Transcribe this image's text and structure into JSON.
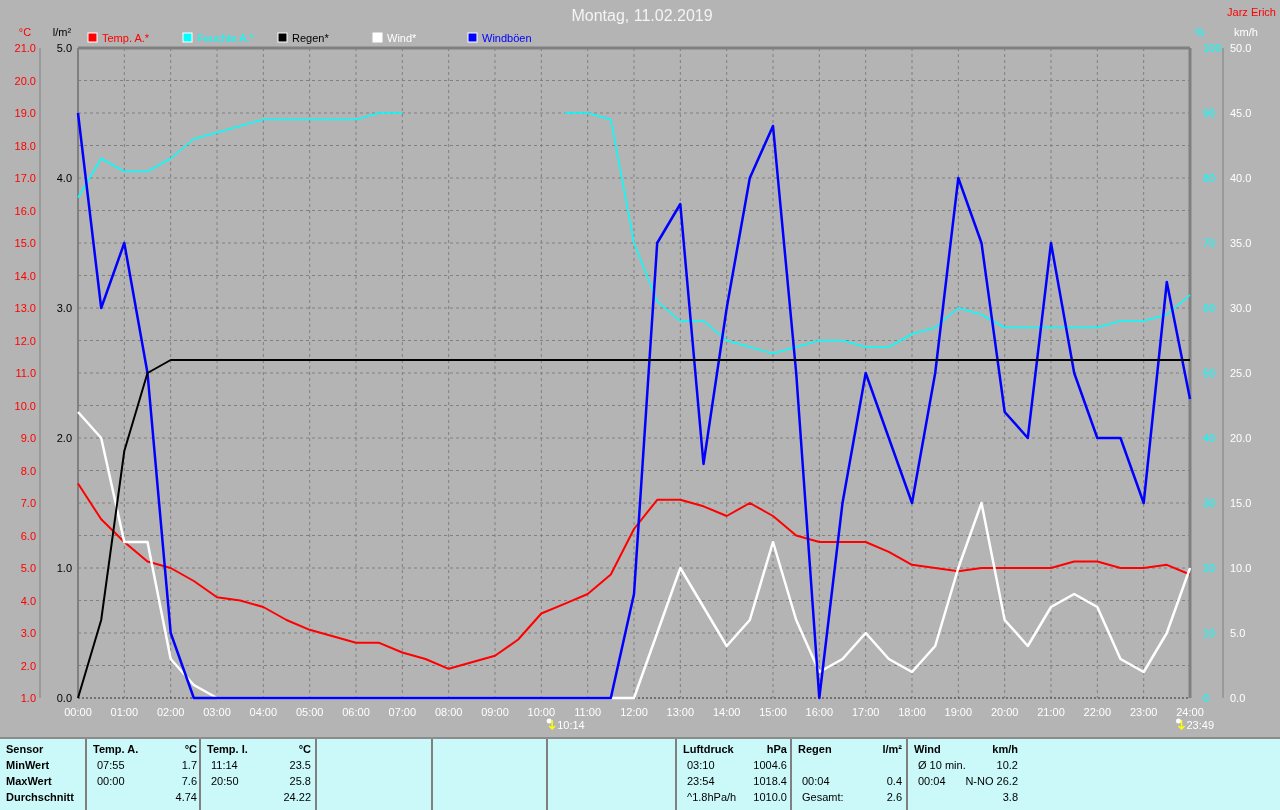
{
  "header": {
    "title": "Montag, 11.02.2019",
    "author": "Jarz Erich"
  },
  "chart": {
    "chart_data": {
      "type": "line",
      "x": [
        0,
        0.5,
        1,
        1.5,
        2,
        2.5,
        3,
        3.5,
        4,
        4.5,
        5,
        5.5,
        6,
        6.5,
        7,
        7.5,
        8,
        8.5,
        9,
        9.5,
        10,
        10.5,
        11,
        11.5,
        12,
        12.5,
        13,
        13.5,
        14,
        14.5,
        15,
        15.5,
        16,
        16.5,
        17,
        17.5,
        18,
        18.5,
        19,
        19.5,
        20,
        20.5,
        21,
        21.5,
        22,
        22.5,
        23,
        23.5,
        24
      ],
      "xlim": [
        0,
        24
      ],
      "xticks": [
        {
          "value": 0,
          "label": "00:00"
        },
        {
          "value": 1,
          "label": "01:00"
        },
        {
          "value": 2,
          "label": "02:00"
        },
        {
          "value": 3,
          "label": "03:00"
        },
        {
          "value": 4,
          "label": "04:00"
        },
        {
          "value": 5,
          "label": "05:00"
        },
        {
          "value": 6,
          "label": "06:00"
        },
        {
          "value": 7,
          "label": "07:00"
        },
        {
          "value": 8,
          "label": "08:00"
        },
        {
          "value": 9,
          "label": "09:00"
        },
        {
          "value": 10,
          "label": "10:00"
        },
        {
          "value": 11,
          "label": "11:00"
        },
        {
          "value": 12,
          "label": "12:00"
        },
        {
          "value": 13,
          "label": "13:00"
        },
        {
          "value": 14,
          "label": "14:00"
        },
        {
          "value": 15,
          "label": "15:00"
        },
        {
          "value": 16,
          "label": "16:00"
        },
        {
          "value": 17,
          "label": "17:00"
        },
        {
          "value": 18,
          "label": "18:00"
        },
        {
          "value": 19,
          "label": "19:00"
        },
        {
          "value": 20,
          "label": "20:00"
        },
        {
          "value": 21,
          "label": "21:00"
        },
        {
          "value": 22,
          "label": "22:00"
        },
        {
          "value": 23,
          "label": "23:00"
        },
        {
          "value": 24,
          "label": "24:00"
        }
      ],
      "ylabel": "°C",
      "ylim": [
        1,
        21
      ],
      "yticks": [
        {
          "value": 21,
          "label": "21.0"
        },
        {
          "value": 20,
          "label": "20.0"
        },
        {
          "value": 19,
          "label": "19.0"
        },
        {
          "value": 18,
          "label": "18.0"
        },
        {
          "value": 17,
          "label": "17.0"
        },
        {
          "value": 16,
          "label": "16.0"
        },
        {
          "value": 15,
          "label": "15.0"
        },
        {
          "value": 14,
          "label": "14.0"
        },
        {
          "value": 13,
          "label": "13.0"
        },
        {
          "value": 12,
          "label": "12.0"
        },
        {
          "value": 11,
          "label": "11.0"
        },
        {
          "value": 10,
          "label": "10.0"
        },
        {
          "value": 9,
          "label": "9.0"
        },
        {
          "value": 8,
          "label": "8.0"
        },
        {
          "value": 7,
          "label": "7.0"
        },
        {
          "value": 6,
          "label": "6.0"
        },
        {
          "value": 5,
          "label": "5.0"
        },
        {
          "value": 4,
          "label": "4.0"
        },
        {
          "value": 3,
          "label": "3.0"
        },
        {
          "value": 2,
          "label": "2.0"
        },
        {
          "value": 1,
          "label": "1.0"
        }
      ],
      "y2label": "km/h",
      "y2lim": [
        0,
        50
      ],
      "y2ticks": [
        {
          "value": 50,
          "label": "50.0"
        },
        {
          "value": 45,
          "label": "45.0"
        },
        {
          "value": 40,
          "label": "40.0"
        },
        {
          "value": 35,
          "label": "35.0"
        },
        {
          "value": 30,
          "label": "30.0"
        },
        {
          "value": 25,
          "label": "25.0"
        },
        {
          "value": 20,
          "label": "20.0"
        },
        {
          "value": 15,
          "label": "15.0"
        },
        {
          "value": 10,
          "label": "10.0"
        },
        {
          "value": 5,
          "label": "5.0"
        },
        {
          "value": 0,
          "label": "0.0"
        }
      ],
      "y3label": "%",
      "y3lim": [
        0,
        100
      ],
      "y3ticks": [
        100,
        90,
        80,
        70,
        60,
        50,
        40,
        30,
        20,
        10,
        0
      ],
      "series": [
        {
          "name": "Temp. A.*",
          "color": "#ff0000",
          "values": [
            7.6,
            6.5,
            5.8,
            5.2,
            5.0,
            4.6,
            4.1,
            4.0,
            3.8,
            3.4,
            3.1,
            2.9,
            2.7,
            2.7,
            2.4,
            2.2,
            1.9,
            2.1,
            2.3,
            2.8,
            3.6,
            3.9,
            4.2,
            4.8,
            6.2,
            7.1,
            7.1,
            6.9,
            6.6,
            7.0,
            6.6,
            6.0,
            5.8,
            5.8,
            5.8,
            5.5,
            5.1,
            5.0,
            4.9,
            5.0,
            5.0,
            5.0,
            5.0,
            5.2,
            5.2,
            5.0,
            5.0,
            5.1,
            4.8
          ]
        },
        {
          "name": "Feuchte A.*",
          "color": "#00ffff",
          "axis": "y3",
          "values": [
            77,
            83,
            81,
            81,
            83,
            86,
            87,
            88,
            89,
            89,
            89,
            89,
            89,
            90,
            90,
            null,
            null,
            null,
            null,
            null,
            null,
            90,
            90,
            89,
            70,
            61,
            58,
            58,
            55,
            54,
            53,
            54,
            55,
            55,
            54,
            54,
            56,
            57,
            60,
            59,
            57,
            57,
            57,
            57,
            57,
            58,
            58,
            59,
            62
          ]
        },
        {
          "name": "Wind*",
          "color": "#ffffff",
          "axis": "y2",
          "values": [
            22,
            20,
            12,
            12,
            3,
            1,
            0,
            0,
            0,
            0,
            0,
            0,
            0,
            0,
            0,
            0,
            0,
            0,
            0,
            0,
            0,
            0,
            0,
            0,
            0,
            5,
            10,
            7,
            4,
            6,
            12,
            6,
            2,
            3,
            5,
            3,
            2,
            4,
            10,
            15,
            6,
            4,
            7,
            8,
            7,
            3,
            2,
            5,
            10
          ]
        },
        {
          "name": "Windböen",
          "color": "#0000ff",
          "axis": "y2",
          "values": [
            45,
            30,
            35,
            25,
            5,
            0,
            0,
            0,
            0,
            0,
            0,
            0,
            0,
            0,
            0,
            0,
            0,
            0,
            0,
            0,
            0,
            0,
            0,
            0,
            8,
            35,
            38,
            18,
            30,
            40,
            44,
            25,
            0,
            15,
            25,
            20,
            15,
            25,
            40,
            35,
            22,
            20,
            35,
            25,
            20,
            20,
            15,
            32,
            23
          ]
        }
      ],
      "grid": true,
      "legend": "top",
      "annotations": [
        "10:14",
        "23:49"
      ]
    }
  },
  "rain_chart": {
    "chart_data": {
      "type": "line",
      "x": [
        0,
        0.5,
        1,
        1.5,
        2,
        2.5,
        3,
        24
      ],
      "xlim": [
        0,
        24
      ],
      "ylabel": "l/m²",
      "ylim": [
        0,
        5
      ],
      "yticks": [
        {
          "value": 5,
          "label": "5.0"
        },
        {
          "value": 4,
          "label": "4.0"
        },
        {
          "value": 3,
          "label": "3.0"
        },
        {
          "value": 2,
          "label": "2.0"
        },
        {
          "value": 1,
          "label": "1.0"
        },
        {
          "value": 0,
          "label": "0.0"
        }
      ],
      "series": [
        {
          "name": "Regen*",
          "color": "#000000",
          "values": [
            0,
            0.6,
            1.9,
            2.5,
            2.6,
            2.6,
            2.6,
            2.6
          ]
        }
      ]
    }
  },
  "stats": {
    "labels": [
      "Sensor",
      "MinWert",
      "MaxWert",
      "Durchschnitt"
    ],
    "panels_left": [
      {
        "title": "Temp. A.",
        "unit": "°C",
        "rows": [
          {
            "time": "07:55",
            "value": "1.7"
          },
          {
            "time": "00:00",
            "value": "7.6"
          },
          {
            "value": "4.74"
          }
        ]
      },
      {
        "title": "Temp. I.",
        "unit": "°C",
        "rows": [
          {
            "time": "11:14",
            "value": "23.5"
          },
          {
            "time": "20:50",
            "value": "25.8"
          },
          {
            "value": "24.22"
          }
        ]
      }
    ],
    "panels_right": [
      {
        "title": "Luftdruck",
        "unit": "hPa",
        "rows": [
          {
            "time": "03:10",
            "value": "1004.6"
          },
          {
            "time": "23:54",
            "value": "1018.4"
          },
          {
            "time": "^1.8hPa/h",
            "value": "1010.0"
          }
        ]
      },
      {
        "title": "Regen",
        "unit": "l/m²",
        "rows": [
          {},
          {
            "time": "00:04",
            "value": "0.4"
          },
          {
            "time": "Gesamt:",
            "value": "2.6"
          }
        ]
      },
      {
        "title": "Wind",
        "unit": "km/h",
        "rows": [
          {
            "time": "Ø 10 min.",
            "value": "10.2"
          },
          {
            "time": "00:04",
            "value": "N-NO 26.2"
          },
          {
            "value": "3.8"
          }
        ]
      }
    ]
  }
}
